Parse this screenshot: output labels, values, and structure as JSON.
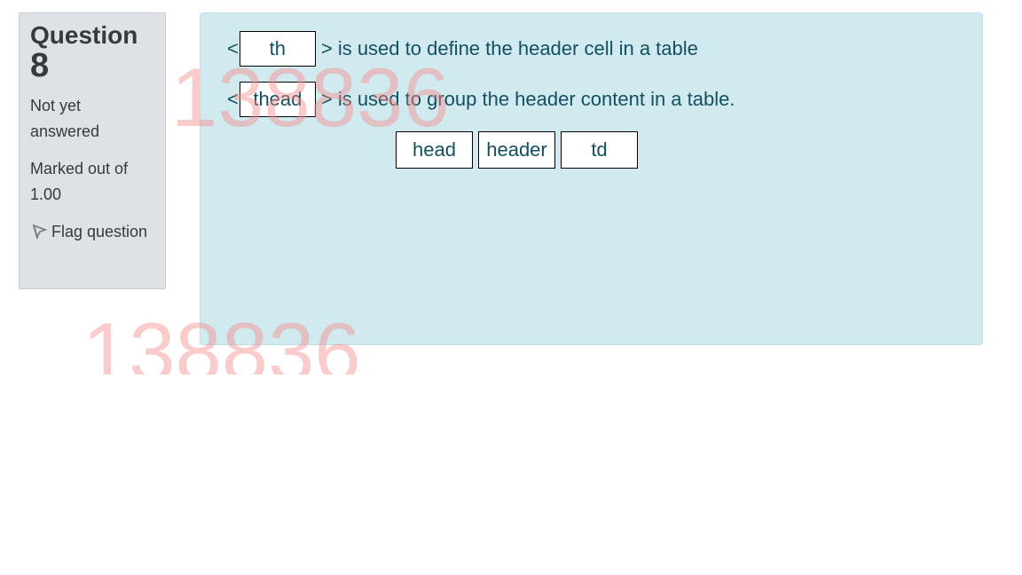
{
  "question_info": {
    "title": "Question",
    "number": "8",
    "status": "Not yet answered",
    "marks": "Marked out of 1.00",
    "flag_label": "Flag question"
  },
  "question": {
    "lines": [
      {
        "prefix": "<",
        "answer": "th",
        "suffix": "> is used to define the header cell in a table"
      },
      {
        "prefix": "<",
        "answer": "thead",
        "suffix": "> is used to group the header content in a table."
      }
    ],
    "choices": [
      "head",
      "header",
      "td"
    ]
  },
  "watermark": "138836",
  "colors": {
    "info_bg": "#dee2e6",
    "content_bg": "#d1eaf0",
    "text": "#145061",
    "watermark": "#f58c8c"
  }
}
